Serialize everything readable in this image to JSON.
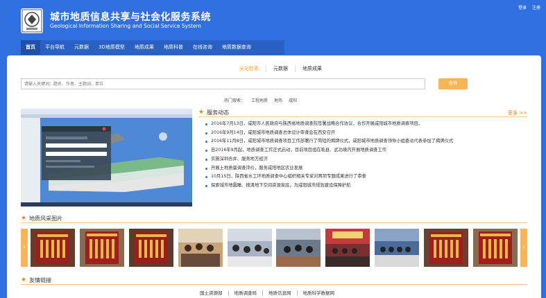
{
  "header": {
    "title_cn": "城市地质信息共享与社会化服务系统",
    "title_en": "Geological Information Sharing and Social Service System",
    "login": "登录",
    "register": "注册"
  },
  "nav": {
    "items": [
      {
        "label": "首页",
        "active": true
      },
      {
        "label": "平台导航"
      },
      {
        "label": "元数据"
      },
      {
        "label": "3D地质模型"
      },
      {
        "label": "地质成果"
      },
      {
        "label": "地质科普"
      },
      {
        "label": "在线咨询"
      },
      {
        "label": "地质数据查询"
      }
    ]
  },
  "search": {
    "tabs": [
      "全站检索",
      "元数据",
      "地质成果"
    ],
    "placeholder": "请输入关键词：题名、作者、主题词、单位",
    "button": "查询",
    "hot_label": "热门搜索：",
    "hot_terms": [
      "工程地质",
      "地热",
      "咸阳"
    ]
  },
  "news": {
    "title": "服务动态",
    "more": "更多 >>",
    "items": [
      "2016年7月13日，咸阳市人民政府与陕西省地质调查院签署战略合作协议，合作开展咸阳城市地质调查项目。",
      "2016年9月14日，咸阳城市地质调查总体设计审查会在西安召开",
      "2016年11月8日，咸阳城市地质调查项目工作部署行了简短的揭牌仪式，咸阳城市地质调查领导小组委派代表参加了揭牌仪式",
      "自2016年9月起，地质调查工作正式启动，目前项目组在乾县、武功境内开展地质调查工作",
      "实施深圳合并、服务地方经济",
      "开展土地质量调查评价，服务咸阳地区农业发展",
      "10月15日，陕西省水工环地质调查中心组织相关专家对两项专题成果进行了审查",
      "探索城市地震睡、搜清地下空间资源家底，为咸阳城市规划建设保障护航"
    ]
  },
  "gallery": {
    "title": "地质风采图片",
    "prev": "‹",
    "next": "›"
  },
  "links": {
    "title": "友情链接",
    "items": [
      "国土资源部",
      "地质调查局",
      "地质信息网",
      "地质科学数据网"
    ]
  },
  "colors": {
    "brand_blue": "#2f6fe0",
    "accent_orange": "#f7b557"
  }
}
